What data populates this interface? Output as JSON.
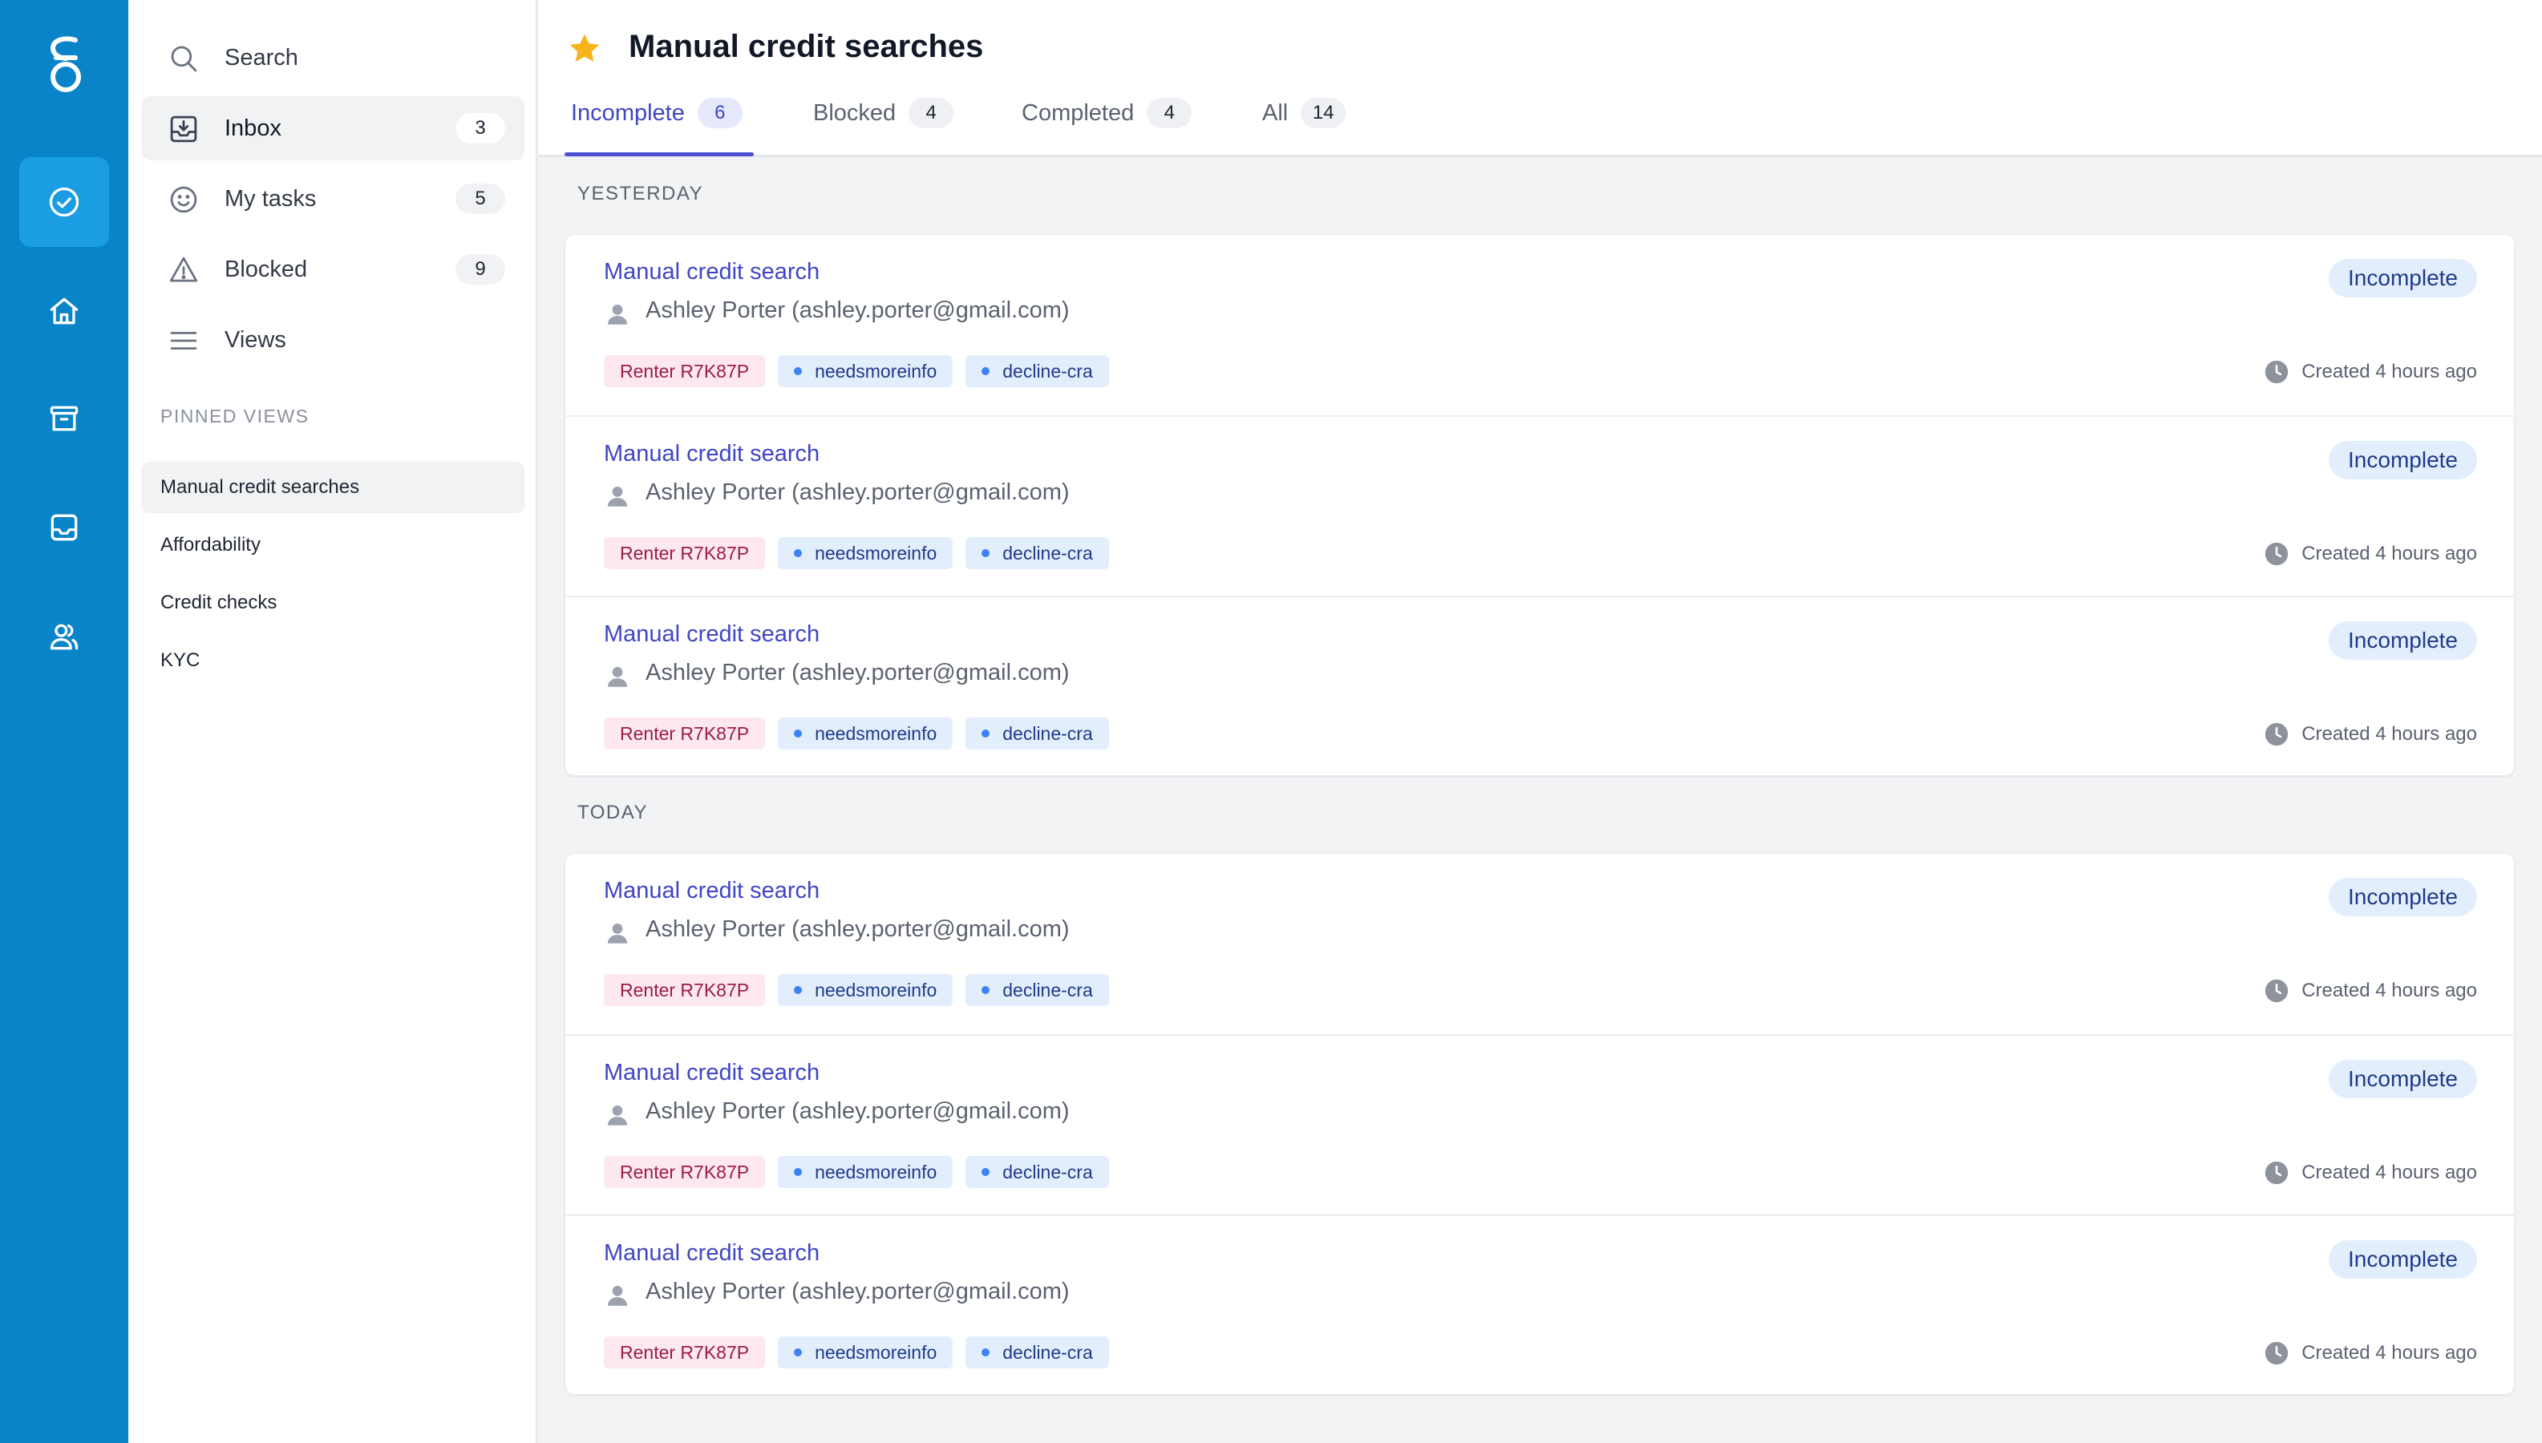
{
  "app": {
    "rail": [
      {
        "name": "check-circle-icon",
        "active": true
      },
      {
        "name": "home-icon",
        "active": false
      },
      {
        "name": "archive-icon",
        "active": false
      },
      {
        "name": "inbox-tray-icon",
        "active": false
      },
      {
        "name": "users-icon",
        "active": false
      }
    ]
  },
  "sidebar": {
    "search_label": "Search",
    "items": [
      {
        "label": "Inbox",
        "count": "3",
        "icon": "inbox-download-icon",
        "active": true
      },
      {
        "label": "My tasks",
        "count": "5",
        "icon": "smile-icon",
        "active": false
      },
      {
        "label": "Blocked",
        "count": "9",
        "icon": "warning-icon",
        "active": false
      },
      {
        "label": "Views",
        "count": "",
        "icon": "menu-icon",
        "active": false
      }
    ],
    "pinned_title": "PINNED VIEWS",
    "pinned": [
      {
        "label": "Manual credit searches",
        "active": true
      },
      {
        "label": "Affordability",
        "active": false
      },
      {
        "label": "Credit checks",
        "active": false
      },
      {
        "label": "KYC",
        "active": false
      }
    ]
  },
  "header": {
    "title": "Manual credit searches",
    "tabs": [
      {
        "label": "Incomplete",
        "count": "6",
        "active": true
      },
      {
        "label": "Blocked",
        "count": "4",
        "active": false
      },
      {
        "label": "Completed",
        "count": "4",
        "active": false
      },
      {
        "label": "All",
        "count": "14",
        "active": false
      }
    ]
  },
  "groups": [
    {
      "label": "YESTERDAY",
      "tasks": [
        {
          "title": "Manual credit search",
          "person": "Ashley Porter (ashley.porter@gmail.com)",
          "renter": "Renter R7K87P",
          "tags": [
            "needsmoreinfo",
            "decline-cra"
          ],
          "status": "Incomplete",
          "created": "Created 4 hours ago"
        },
        {
          "title": "Manual credit search",
          "person": "Ashley Porter (ashley.porter@gmail.com)",
          "renter": "Renter R7K87P",
          "tags": [
            "needsmoreinfo",
            "decline-cra"
          ],
          "status": "Incomplete",
          "created": "Created 4 hours ago"
        },
        {
          "title": "Manual credit search",
          "person": "Ashley Porter (ashley.porter@gmail.com)",
          "renter": "Renter R7K87P",
          "tags": [
            "needsmoreinfo",
            "decline-cra"
          ],
          "status": "Incomplete",
          "created": "Created 4 hours ago"
        }
      ]
    },
    {
      "label": "TODAY",
      "tasks": [
        {
          "title": "Manual credit search",
          "person": "Ashley Porter (ashley.porter@gmail.com)",
          "renter": "Renter R7K87P",
          "tags": [
            "needsmoreinfo",
            "decline-cra"
          ],
          "status": "Incomplete",
          "created": "Created 4 hours ago"
        },
        {
          "title": "Manual credit search",
          "person": "Ashley Porter (ashley.porter@gmail.com)",
          "renter": "Renter R7K87P",
          "tags": [
            "needsmoreinfo",
            "decline-cra"
          ],
          "status": "Incomplete",
          "created": "Created 4 hours ago"
        },
        {
          "title": "Manual credit search",
          "person": "Ashley Porter (ashley.porter@gmail.com)",
          "renter": "Renter R7K87P",
          "tags": [
            "needsmoreinfo",
            "decline-cra"
          ],
          "status": "Incomplete",
          "created": "Created 4 hours ago"
        }
      ]
    }
  ],
  "colors": {
    "rail": "#0a84c8",
    "accent": "#3f45c4",
    "status_bg": "#e3eefc",
    "renter_bg": "#fde8ef",
    "star": "#f5b41b"
  }
}
